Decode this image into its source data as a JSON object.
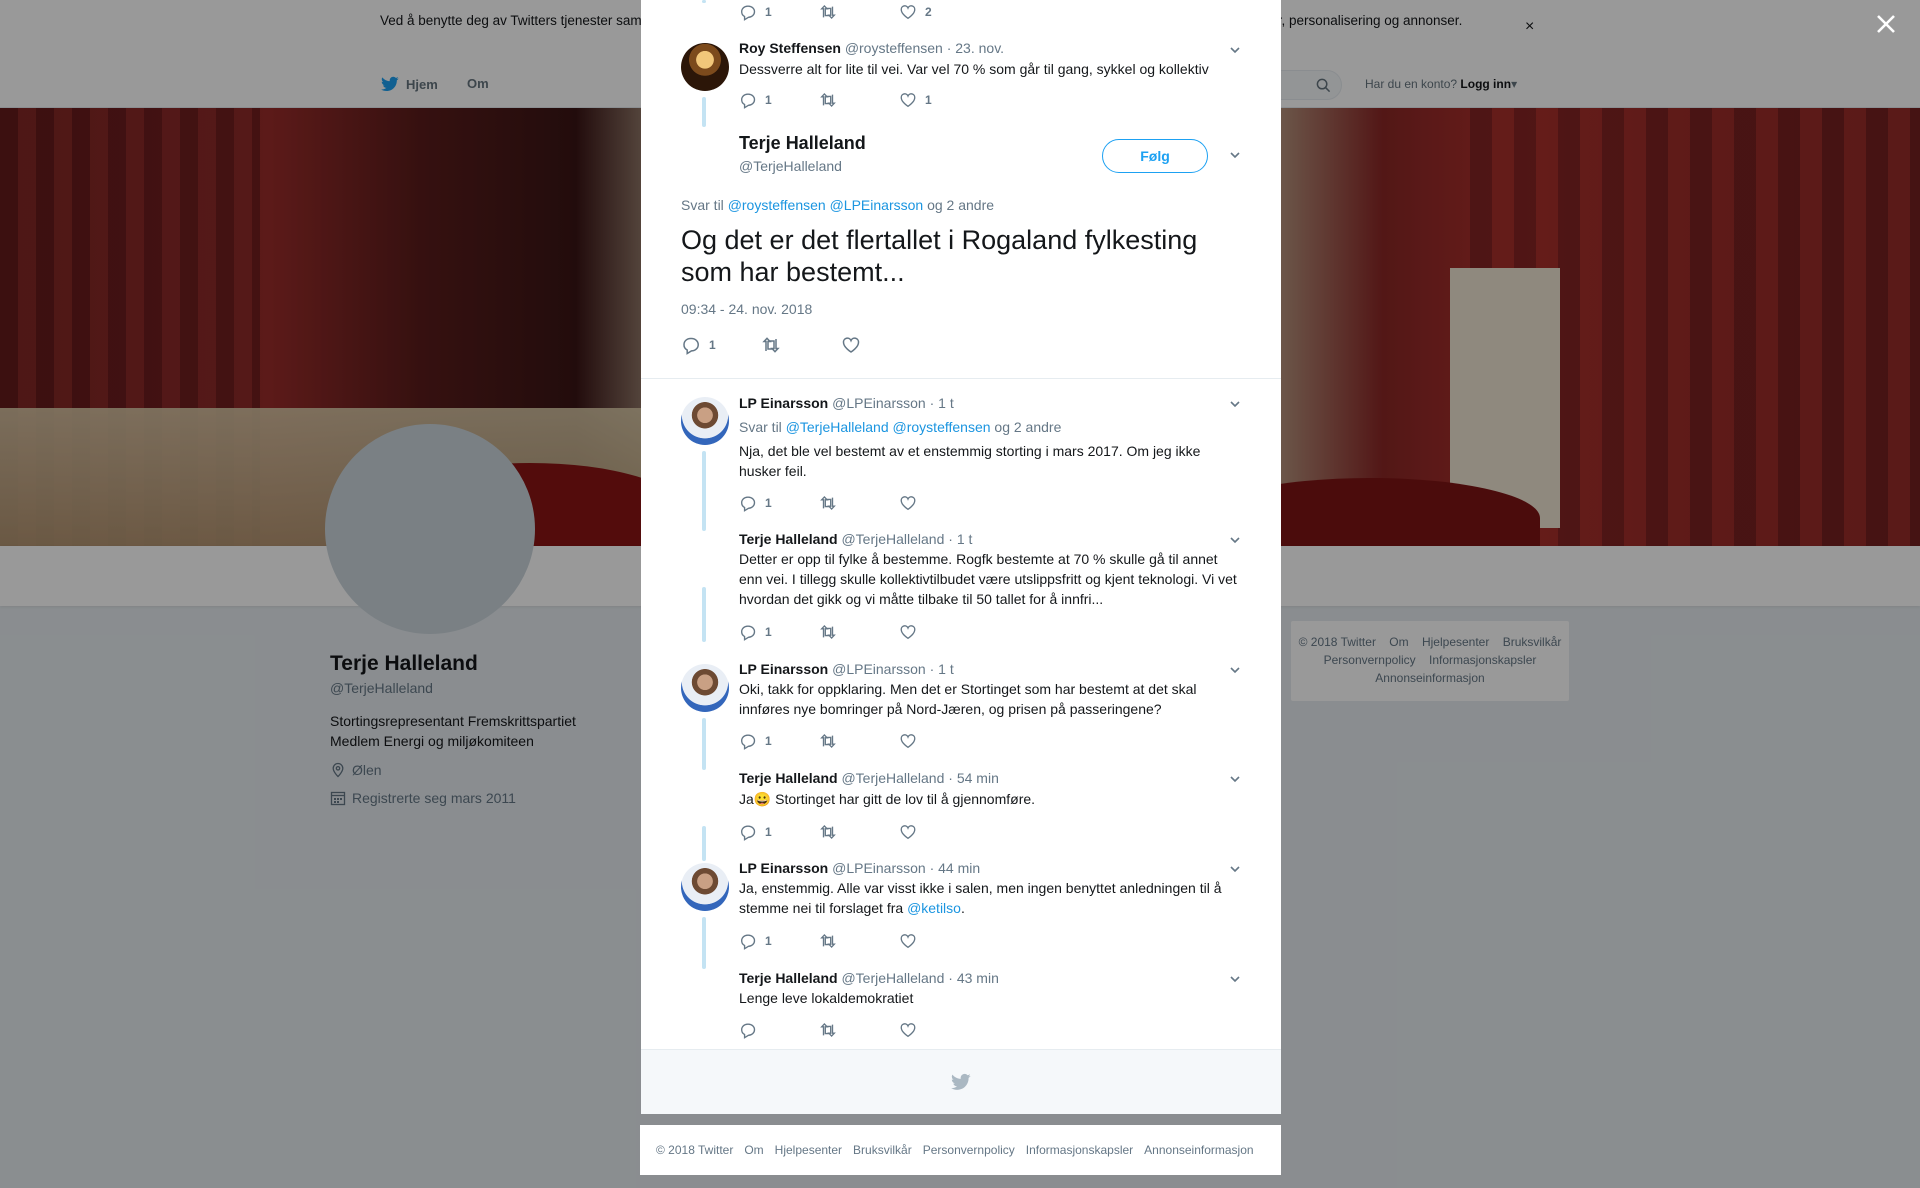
{
  "cookie_banner": {
    "text": "Ved å benytte deg av Twitters tjenester samtykker du i vår bruk av informasjonskapsler. Vi og våre partnere bruker informasjonskapsler til bl.a. analyser, personalisering og annonser.",
    "close": "×"
  },
  "topnav": {
    "home": "Hjem",
    "about": "Om",
    "account_prompt": "Har du en konto?",
    "login": "Logg inn"
  },
  "profile": {
    "name": "Terje Halleland",
    "handle": "@TerjeHalleland",
    "bio_line1": "Stortingsrepresentant Fremskrittspartiet",
    "bio_line2": "Medlem Energi og miljøkomiteen",
    "location": "Ølen",
    "joined": "Registrerte seg mars 2011"
  },
  "side_footer": {
    "copyright": "© 2018 Twitter",
    "links": [
      "Om",
      "Hjelpesenter",
      "Bruksvilkår",
      "Personvernpolicy",
      "Informasjonskapsler",
      "Annonseinformasjon"
    ]
  },
  "modal": {
    "top_tweet": {
      "replies": "1",
      "likes": "2"
    },
    "parent_tweet": {
      "name": "Roy Steffensen",
      "handle": "@roysteffensen",
      "time": "· 23. nov.",
      "text": "Dessverre alt for lite til vei. Var vel 70 % som går til gang, sykkel og kollektiv",
      "replies": "1",
      "likes": "1"
    },
    "main_tweet": {
      "name": "Terje Halleland",
      "handle": "@TerjeHalleland",
      "follow": "Følg",
      "reply_prefix": "Svar til",
      "reply_to_1": "@roysteffensen",
      "reply_to_2": "@LPEinarsson",
      "reply_suffix": "og 2 andre",
      "text": "Og det er det flertallet i Rogaland fylkesting som har bestemt...",
      "timestamp": "09:34 - 24. nov. 2018",
      "replies": "1"
    },
    "replies": [
      {
        "name": "LP Einarsson",
        "handle": "@LPEinarsson",
        "time": "· 1 t",
        "reply_prefix": "Svar til",
        "reply_to_1": "@TerjeHalleland",
        "reply_to_2": "@roysteffensen",
        "reply_suffix": "og 2 andre",
        "text": "Nja, det ble vel bestemt av et enstemmig storting i mars 2017. Om jeg ikke husker feil.",
        "replies": "1"
      },
      {
        "name": "Terje Halleland",
        "handle": "@TerjeHalleland",
        "time": "· 1 t",
        "text": "Detter er opp til fylke å bestemme. Rogfk bestemte at 70 % skulle gå til annet enn vei. I tillegg skulle kollektivtilbudet være utslippsfritt og kjent teknologi. Vi vet hvordan det gikk og vi måtte tilbake til 50 tallet for å innfri...",
        "replies": "1"
      },
      {
        "name": "LP Einarsson",
        "handle": "@LPEinarsson",
        "time": "· 1 t",
        "text": "Oki, takk for oppklaring. Men det er Stortinget som har bestemt at det skal innføres nye bomringer på Nord-Jæren, og prisen på passeringene?",
        "replies": "1"
      },
      {
        "name": "Terje Halleland",
        "handle": "@TerjeHalleland",
        "time": "· 54 min",
        "text_a": "Ja",
        "emoji": "😀",
        "text_b": " Stortinget har gitt de lov til å gjennomføre.",
        "replies": "1"
      },
      {
        "name": "LP Einarsson",
        "handle": "@LPEinarsson",
        "time": "· 44 min",
        "text_a": "Ja, enstemmig. Alle var visst ikke i salen, men ingen benyttet anledningen til å stemme nei til forslaget fra ",
        "mention": "@ketilso",
        "text_b": ".",
        "replies": "1"
      },
      {
        "name": "Terje Halleland",
        "handle": "@TerjeHalleland",
        "time": "· 43 min",
        "text": "Lenge leve lokaldemokratiet"
      }
    ]
  },
  "modal_footer": {
    "copyright": "© 2018 Twitter",
    "links": [
      "Om",
      "Hjelpesenter",
      "Bruksvilkår",
      "Personvernpolicy",
      "Informasjonskapsler",
      "Annonseinformasjon"
    ]
  },
  "colors": {
    "accent": "#1da1f2",
    "link": "#1b95e0",
    "muted": "#657786",
    "thread_line": "#c4e3f3"
  }
}
